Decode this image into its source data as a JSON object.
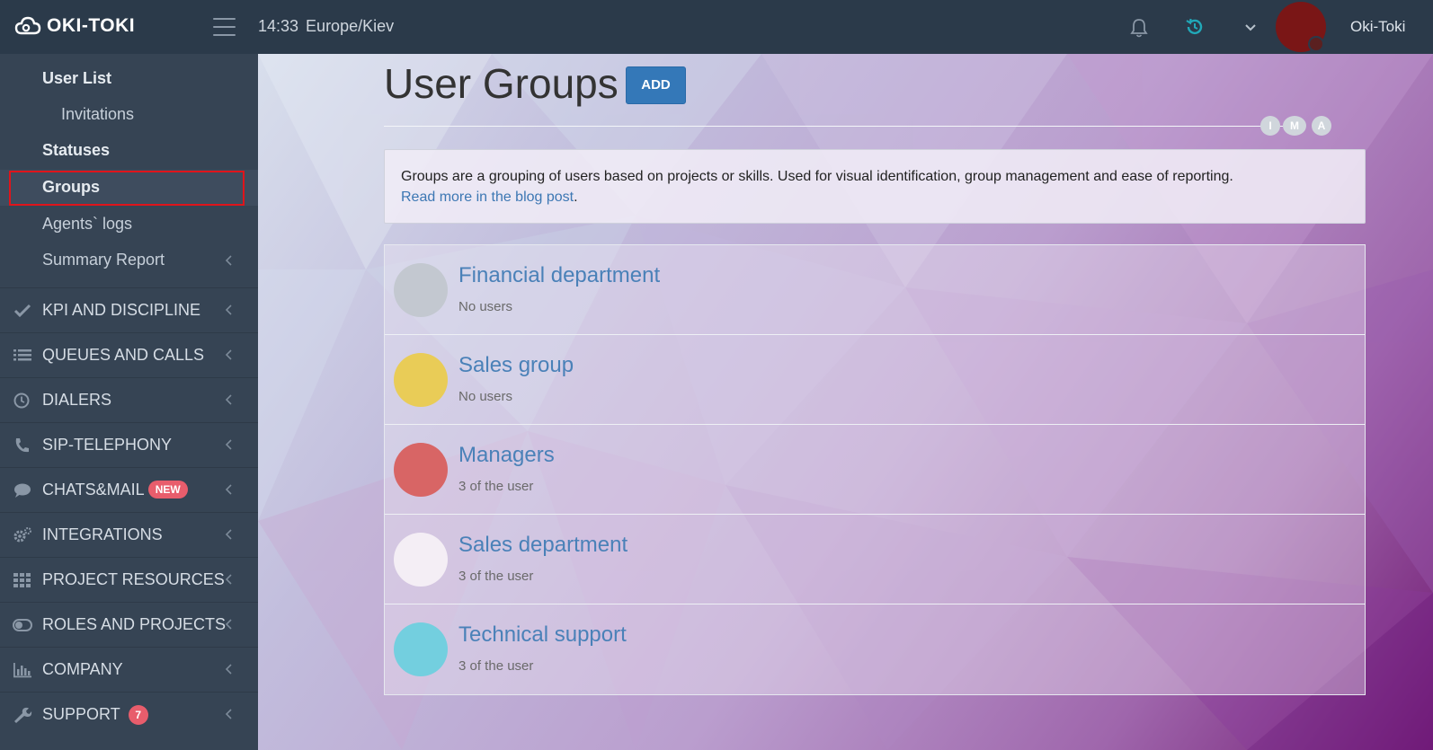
{
  "header": {
    "logo_text": "OKI-TOKI",
    "time": "14:33",
    "timezone": "Europe/Kiev",
    "username": "Oki-Toki"
  },
  "sidebar": {
    "sub_items": [
      {
        "label": "User List",
        "bold": true
      },
      {
        "label": "Invitations",
        "bold": false
      },
      {
        "label": "Statuses",
        "bold": true
      },
      {
        "label": "Groups",
        "bold": true,
        "active": true
      },
      {
        "label": "Agents` logs",
        "bold": false
      },
      {
        "label": "Summary Report",
        "bold": false
      }
    ],
    "sections": [
      {
        "label": "KPI AND DISCIPLINE",
        "icon": "check-icon"
      },
      {
        "label": "QUEUES AND CALLS",
        "icon": "list-icon"
      },
      {
        "label": "DIALERS",
        "icon": "clock-icon"
      },
      {
        "label": "SIP-TELEPHONY",
        "icon": "phone-icon"
      },
      {
        "label": "CHATS&MAIL",
        "icon": "chat-icon",
        "badge": "NEW"
      },
      {
        "label": "INTEGRATIONS",
        "icon": "gears-icon"
      },
      {
        "label": "PROJECT RESOURCES",
        "icon": "grid-icon"
      },
      {
        "label": "ROLES AND PROJECTS",
        "icon": "toggle-icon"
      },
      {
        "label": "COMPANY",
        "icon": "bar-chart-icon"
      },
      {
        "label": "SUPPORT",
        "icon": "wrench-icon",
        "badge_count": "7"
      }
    ]
  },
  "main": {
    "title": "User Groups",
    "add_label": "ADD",
    "view_toggles": [
      "I",
      "M",
      "A"
    ],
    "info_text": "Groups are a grouping of users based on projects or skills. Used for visual identification, group management and ease of reporting.",
    "info_link": "Read more in the blog post",
    "info_link_suffix": ".",
    "groups": [
      {
        "name": "Financial department",
        "count": "No users",
        "color": "#c3c8d0"
      },
      {
        "name": "Sales group",
        "count": "No users",
        "color": "#e9cc57"
      },
      {
        "name": "Managers",
        "count": "3 of the user",
        "color": "#d86565"
      },
      {
        "name": "Sales department",
        "count": "3 of the user",
        "color": "#f4eef5"
      },
      {
        "name": "Technical support",
        "count": "3 of the user",
        "color": "#73cfdf"
      }
    ]
  },
  "colors": {
    "accent": "#3478b8",
    "highlight": "#e0141b",
    "badge": "#e85d6c",
    "sidebar_bg": "#364454",
    "topbar_bg": "#2b3a4a"
  }
}
